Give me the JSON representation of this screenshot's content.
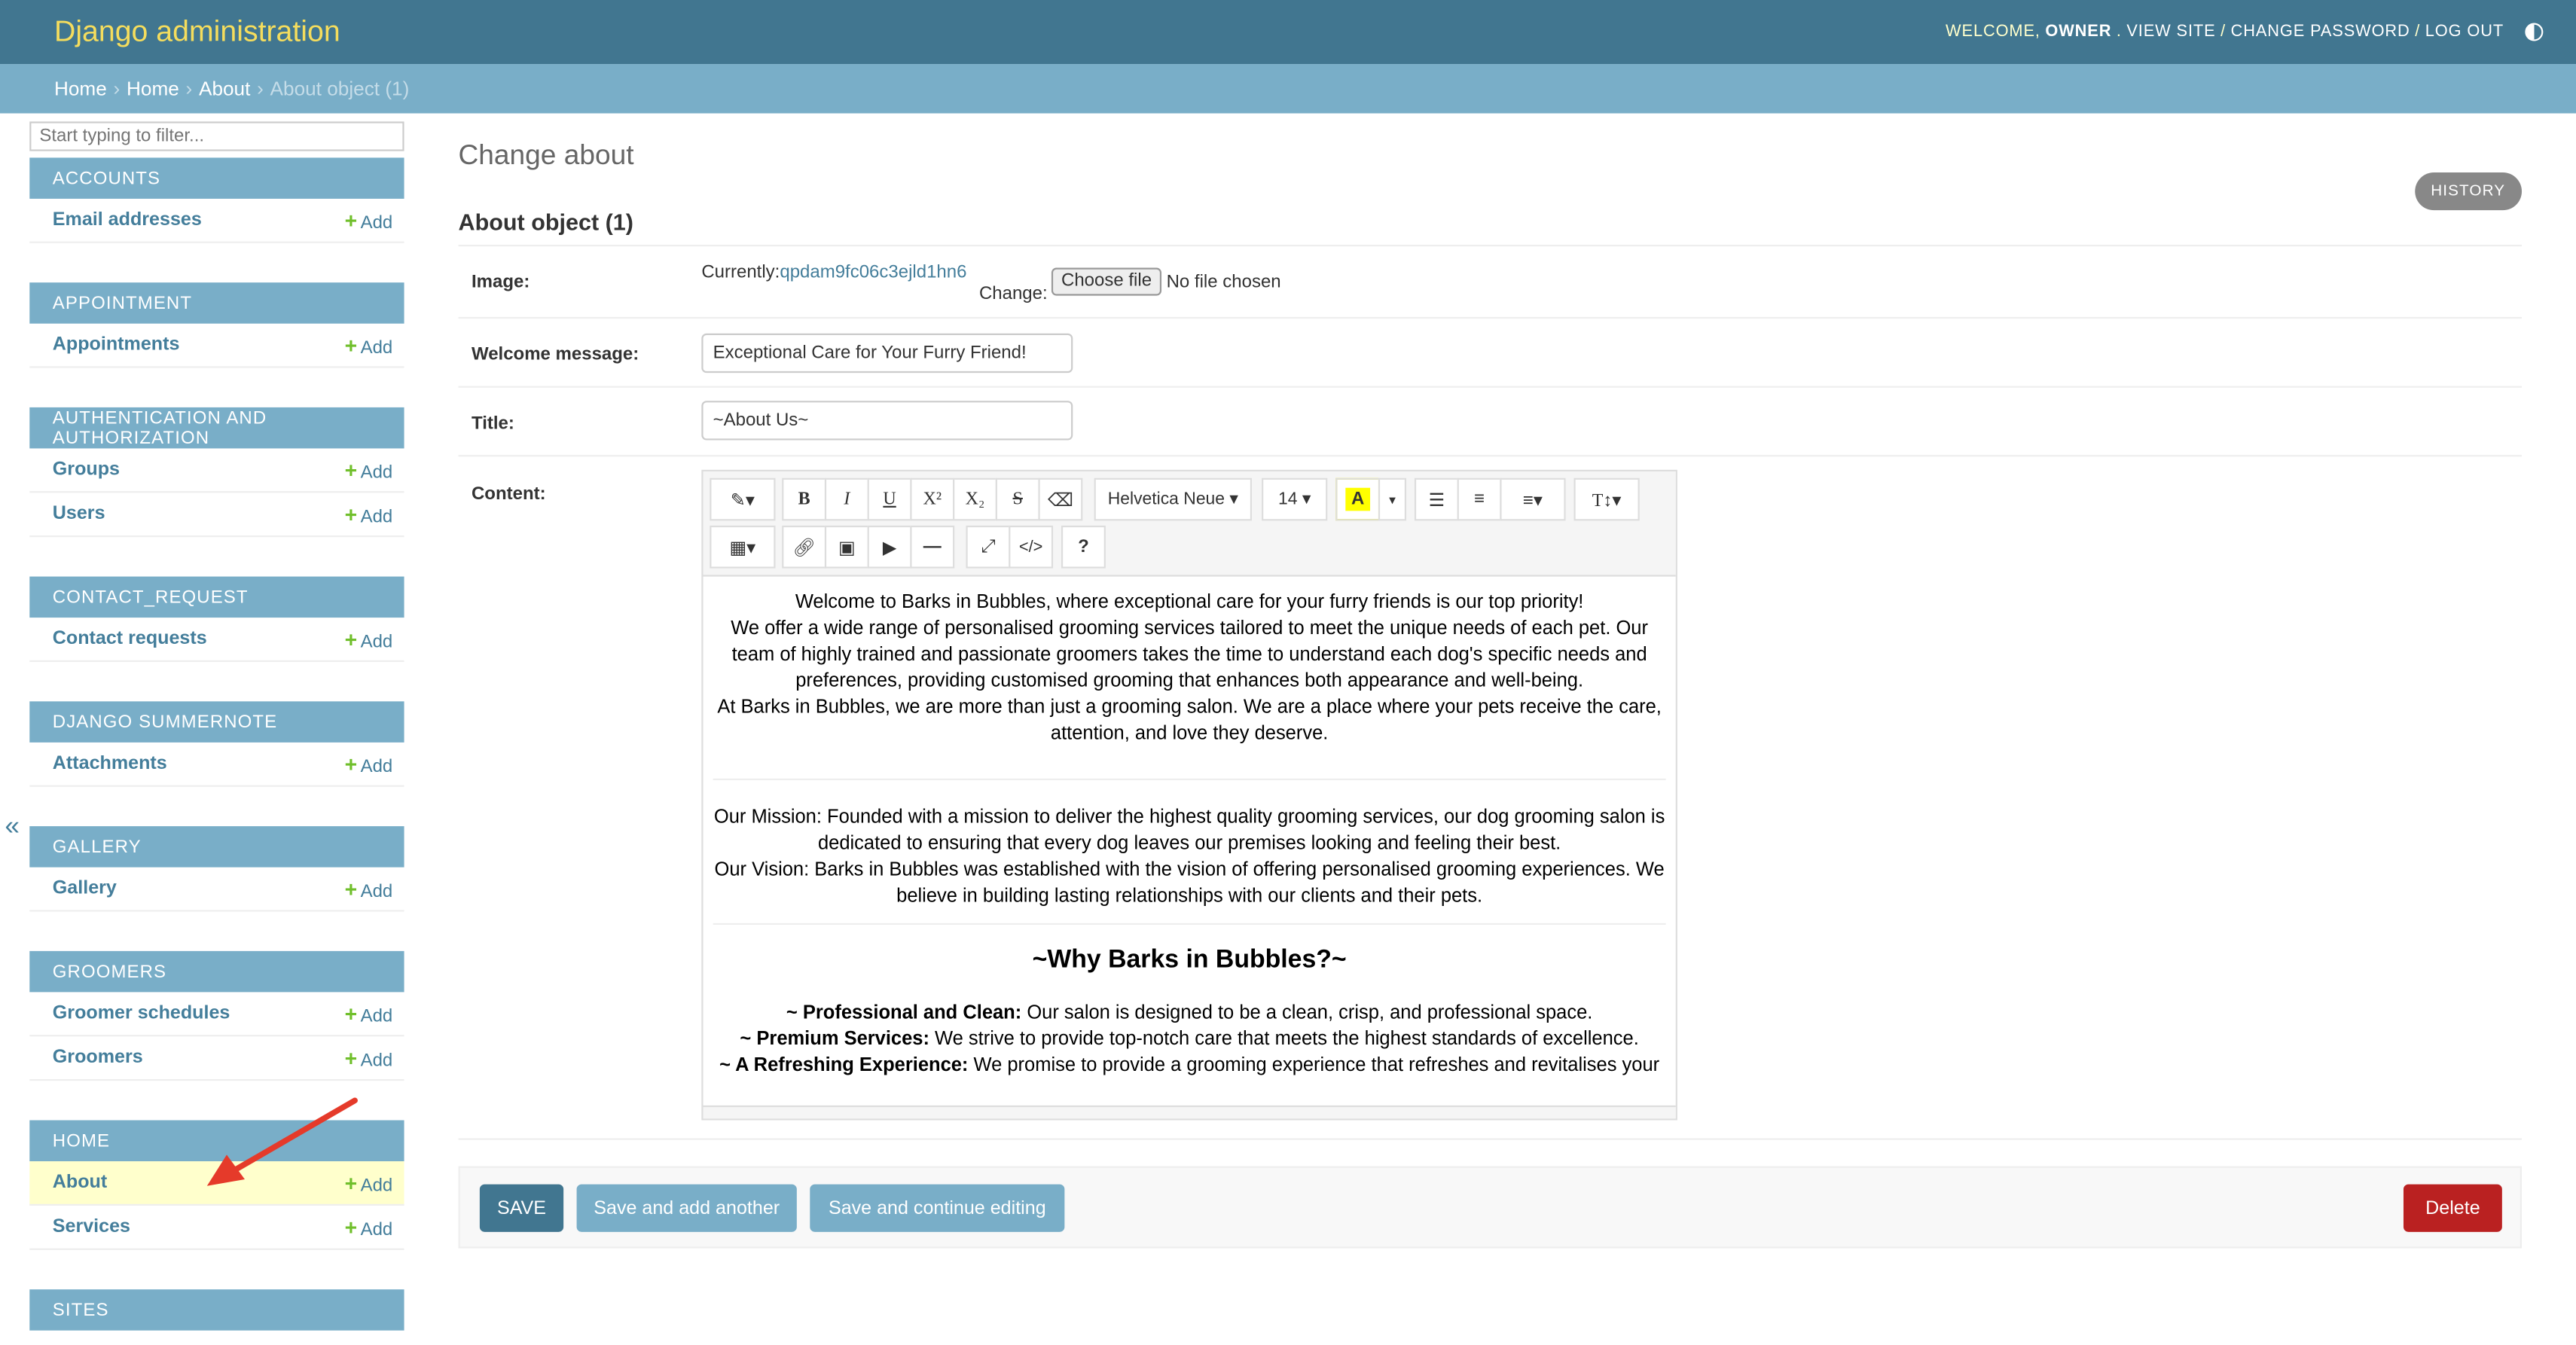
{
  "header": {
    "brand": "Django administration",
    "welcome": "WELCOME,",
    "user": "OWNER",
    "dot": ".",
    "view_site": "VIEW SITE",
    "change_password": "CHANGE PASSWORD",
    "log_out": "LOG OUT",
    "sep": "/"
  },
  "breadcrumbs": {
    "items": [
      "Home",
      "Home",
      "About"
    ],
    "current": "About object (1)",
    "sep": "›"
  },
  "sidebar": {
    "filter_placeholder": "Start typing to filter...",
    "add_label": "Add",
    "collapse": "«",
    "apps": [
      {
        "name": "ACCOUNTS",
        "models": [
          "Email addresses"
        ]
      },
      {
        "name": "APPOINTMENT",
        "models": [
          "Appointments"
        ]
      },
      {
        "name": "AUTHENTICATION AND AUTHORIZATION",
        "models": [
          "Groups",
          "Users"
        ]
      },
      {
        "name": "CONTACT_REQUEST",
        "models": [
          "Contact requests"
        ]
      },
      {
        "name": "DJANGO SUMMERNOTE",
        "models": [
          "Attachments"
        ]
      },
      {
        "name": "GALLERY",
        "models": [
          "Gallery"
        ]
      },
      {
        "name": "GROOMERS",
        "models": [
          "Groomer schedules",
          "Groomers"
        ]
      },
      {
        "name": "HOME",
        "models": [
          "About",
          "Services"
        ]
      },
      {
        "name": "SITES",
        "models": []
      }
    ]
  },
  "main": {
    "title": "Change about",
    "subtitle": "About object (1)",
    "history": "HISTORY",
    "image": {
      "label": "Image:",
      "currently": "Currently:",
      "file": "qpdam9fc06c3ejld1hn6",
      "change": "Change:",
      "choose": "Choose file",
      "no_file": "No file chosen"
    },
    "welcome": {
      "label": "Welcome message:",
      "value": "Exceptional Care for Your Furry Friend!"
    },
    "title_field": {
      "label": "Title:",
      "value": "~About Us~"
    },
    "content": {
      "label": "Content:",
      "font": "Helvetica Neue",
      "size": "14",
      "p1": "Welcome to Barks in Bubbles, where exceptional care for your furry friends is our top priority!",
      "p2": "We offer a wide range of personalised grooming services tailored to meet the unique needs of each pet. Our team of highly trained and passionate groomers takes the time to understand each dog's specific needs and preferences, providing customised grooming that enhances both appearance and well-being.",
      "p3": "At Barks in Bubbles, we are more than just a grooming salon. We are a place where your pets receive the care, attention, and love they deserve.",
      "p4": "Our Mission: Founded with a mission to deliver the highest quality grooming services, our dog grooming salon is dedicated to ensuring that every dog leaves our premises looking and feeling their best.",
      "p5": "Our Vision: Barks in Bubbles was established with the vision of offering personalised grooming experiences. We believe in building lasting relationships with our clients and their pets.",
      "heading": "~Why Barks in Bubbles?~",
      "b1_strong": "~ Professional and Clean:",
      "b1": " Our salon is designed to be a clean, crisp, and professional space.",
      "b2_strong": "~ Premium Services:",
      "b2": " We strive to provide top-notch care that meets the highest standards of excellence.",
      "b3_strong": "~ A Refreshing Experience:",
      "b3": " We promise to provide a grooming experience that refreshes and revitalises your"
    }
  },
  "actions": {
    "save": "SAVE",
    "save_add": "Save and add another",
    "save_continue": "Save and continue editing",
    "delete": "Delete"
  },
  "colors": {
    "header": "#417690",
    "accent": "#79aec8",
    "link": "#447e9b",
    "brand": "#f5dd5d",
    "save": "#417690",
    "delete": "#ba2121",
    "annotation": "#e53a2a"
  }
}
